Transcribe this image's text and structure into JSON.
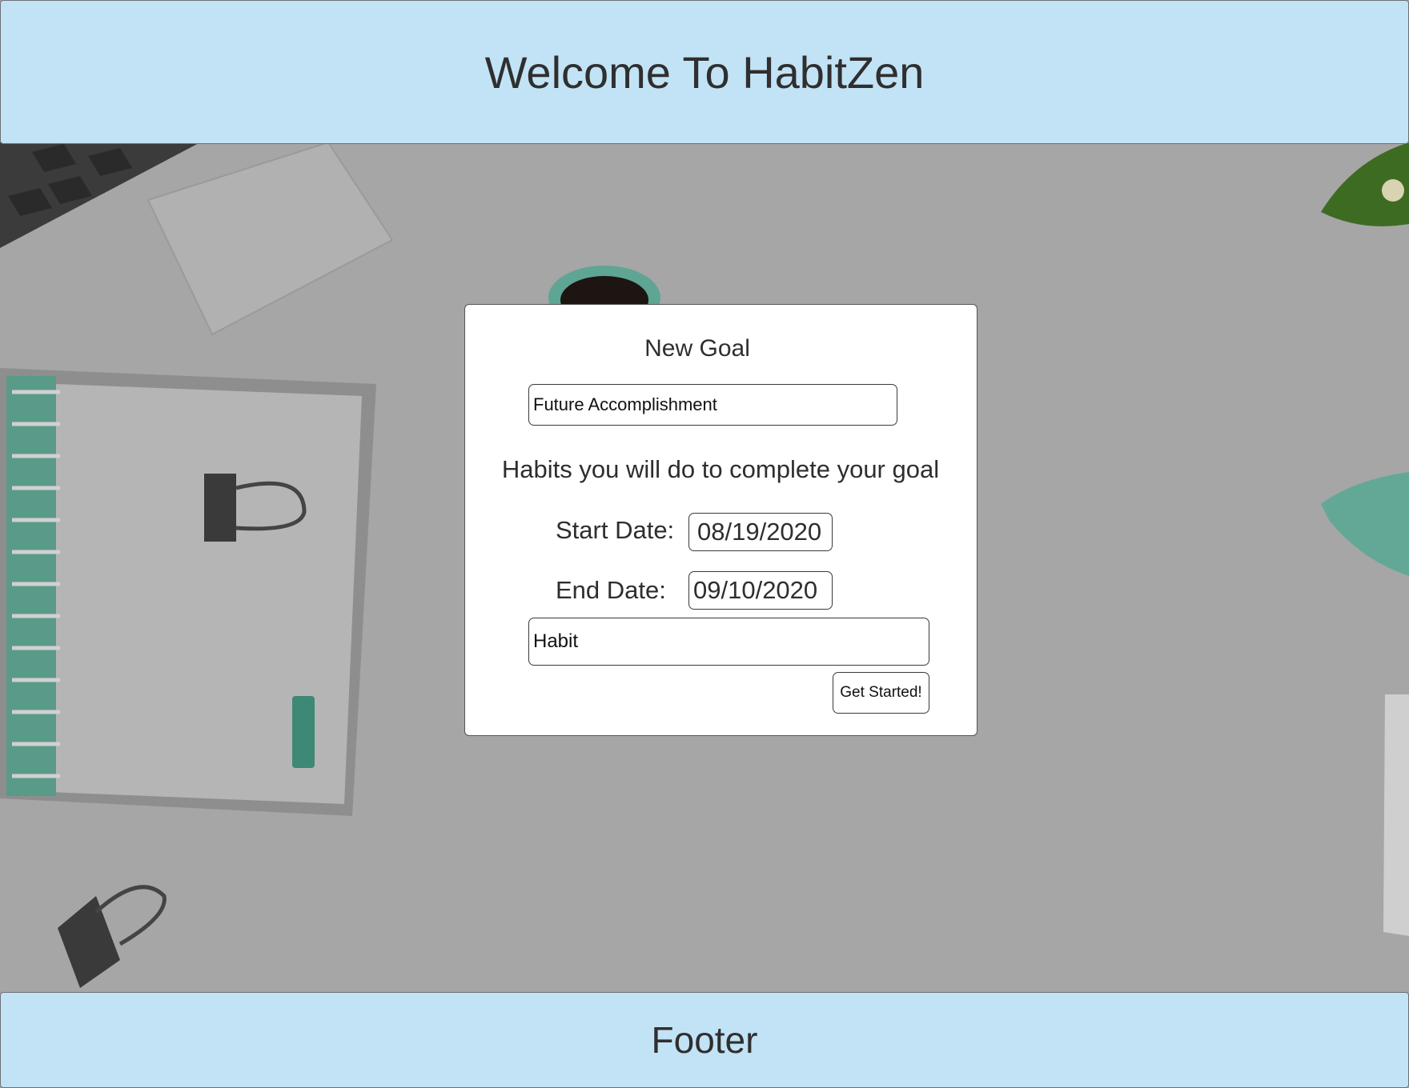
{
  "header": {
    "title": "Welcome To HabitZen"
  },
  "form": {
    "title": "New Goal",
    "goal_input": {
      "placeholder": "Future Accomplishment"
    },
    "habits_heading": "Habits you will do to complete your goal",
    "start_date": {
      "label": "Start Date:",
      "value": "08/19/2020"
    },
    "end_date": {
      "label": "End Date:",
      "value": "09/10/2020"
    },
    "habit_input": {
      "placeholder": "Habit"
    },
    "submit_label": "Get Started!"
  },
  "footer": {
    "text": "Footer"
  },
  "colors": {
    "bar_background": "#c2e3f5",
    "page_background": "#a7a7a7",
    "card_background": "#ffffff"
  }
}
